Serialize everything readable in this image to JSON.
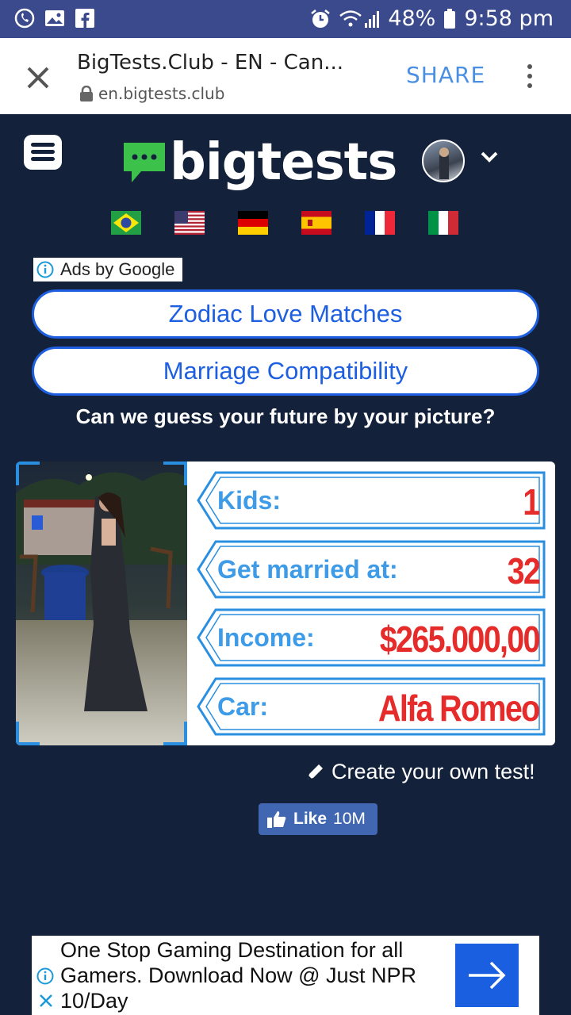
{
  "status_bar": {
    "battery": "48%",
    "time": "9:58 pm",
    "icons": [
      "viber-icon",
      "gallery-icon",
      "facebook-icon",
      "alarm-icon",
      "wifi-icon",
      "signal-icon",
      "battery-icon"
    ]
  },
  "browser": {
    "title": "BigTests.Club - EN - Can...",
    "url": "en.bigtests.club",
    "share_label": "SHARE"
  },
  "site": {
    "logo_text": "bigtests",
    "languages": [
      "brazil-flag",
      "usa-flag",
      "germany-flag",
      "spain-flag",
      "france-flag",
      "italy-flag"
    ]
  },
  "ads": {
    "label": "Ads by Google",
    "links": [
      {
        "label": "Zodiac Love Matches"
      },
      {
        "label": "Marriage Compatibility"
      }
    ]
  },
  "test": {
    "headline": "Can we guess your future by your picture?",
    "results": [
      {
        "label": "Kids:",
        "value": "1"
      },
      {
        "label": "Get married at:",
        "value": "32"
      },
      {
        "label": "Income:",
        "value": "$265.000,00"
      },
      {
        "label": "Car:",
        "value": "Alfa Romeo"
      }
    ]
  },
  "actions": {
    "create_label": "Create your own test!",
    "like_label": "Like",
    "like_count": "10M"
  },
  "bottom_ad": {
    "text": "One Stop Gaming Destination for all Gamers. Download Now @ Just NPR 10/Day"
  },
  "colors": {
    "background": "#13223a",
    "status_bar": "#3a4a8c",
    "accent_blue": "#1d5fe0",
    "label_blue": "#3d9be8",
    "value_red": "#e62b2b",
    "logo_green": "#3cc24a"
  }
}
